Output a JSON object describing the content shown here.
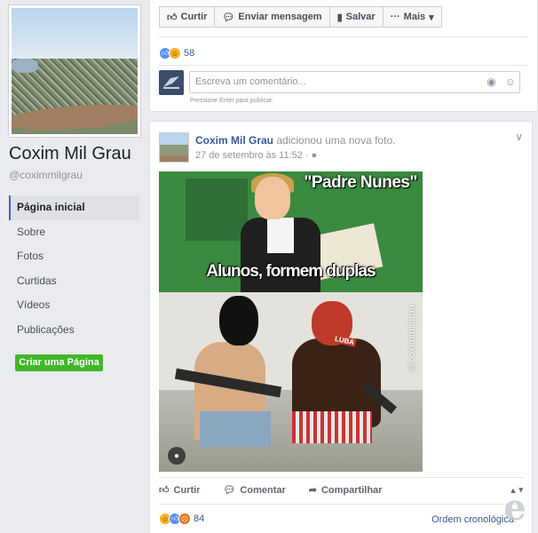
{
  "page": {
    "name": "Coxim Mil Grau",
    "handle": "@coximmilgrau"
  },
  "sidebar": {
    "items": [
      {
        "label": "Página inicial",
        "active": true
      },
      {
        "label": "Sobre",
        "active": false
      },
      {
        "label": "Fotos",
        "active": false
      },
      {
        "label": "Curtidas",
        "active": false
      },
      {
        "label": "Vídeos",
        "active": false
      },
      {
        "label": "Publicações",
        "active": false
      }
    ],
    "create_page_label": "Criar uma Página"
  },
  "top_card": {
    "actions": {
      "like": "Curtir",
      "message": "Enviar mensagem",
      "save": "Salvar",
      "more": "Mais"
    },
    "reaction_count": "58",
    "comment_placeholder": "Escreva um comentário...",
    "press_hint": "Pressione Enter para publicar."
  },
  "post": {
    "author": "Coxim Mil Grau",
    "action_text": "adicionou uma nova foto.",
    "timestamp": "27 de setembro às 11:52 ·",
    "image": {
      "title_text": "\"Padre Nunes\"",
      "caption_text": "Alunos, formem duplas",
      "watermark": "@coximmilgrau",
      "shirt_text": "LUBA"
    },
    "actions": {
      "like": "Curtir",
      "comment": "Comentar",
      "share": "Compartilhar"
    },
    "reaction_count": "84",
    "order_link": "Ordem cronológica"
  },
  "colors": {
    "link": "#365899",
    "green": "#42b72a",
    "background": "#e9ebee"
  }
}
